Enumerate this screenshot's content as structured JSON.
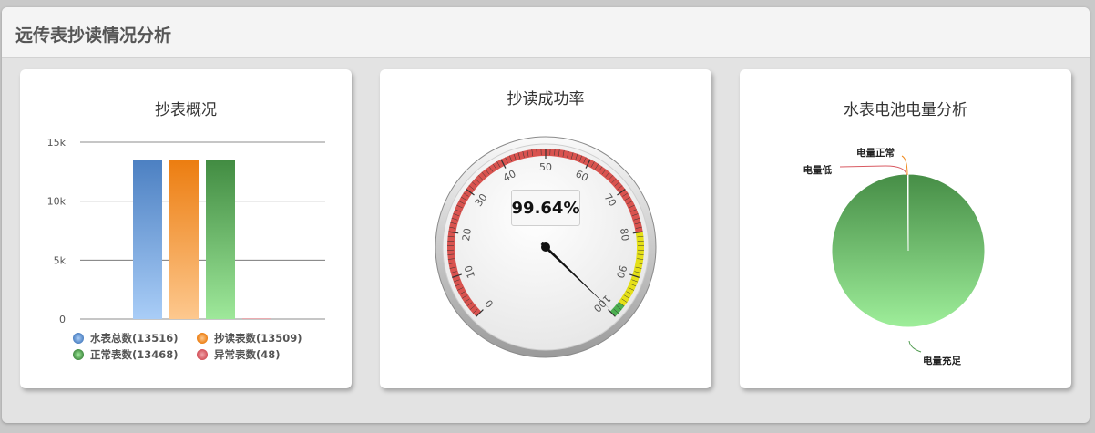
{
  "page": {
    "title": "远传表抄读情况分析"
  },
  "cards": {
    "overview": {
      "title": "抄表概况",
      "chart_data": {
        "type": "bar",
        "categories": [
          "水表总数",
          "抄读表数",
          "正常表数",
          "异常表数"
        ],
        "values": [
          13516,
          13509,
          13468,
          48
        ],
        "yticks": [
          "0",
          "5k",
          "10k",
          "15k"
        ],
        "ylim": [
          0,
          15000
        ],
        "legend": [
          "水表总数(13516)",
          "抄读表数(13509)",
          "正常表数(13468)",
          "异常表数(48)"
        ],
        "colors": [
          "#5b8fcf",
          "#f08a1e",
          "#4f9a4f",
          "#d95b63"
        ]
      }
    },
    "success": {
      "title": "抄读成功率",
      "value_text": "99.64%",
      "chart_data": {
        "type": "gauge",
        "value": 99.64,
        "min": 0,
        "max": 100,
        "tick_labels": [
          "0",
          "10",
          "20",
          "30",
          "40",
          "50",
          "60",
          "70",
          "80",
          "90",
          "100"
        ],
        "bands": [
          {
            "from": 0,
            "to": 80,
            "color": "#d9534f"
          },
          {
            "from": 80,
            "to": 97,
            "color": "#e5e017"
          },
          {
            "from": 97,
            "to": 100,
            "color": "#4caf50"
          }
        ]
      }
    },
    "battery": {
      "title": "水表电池电量分析",
      "chart_data": {
        "type": "pie",
        "categories": [
          "电量充足",
          "电量正常",
          "电量低"
        ],
        "values": [
          99.9,
          0.05,
          0.05
        ],
        "colors": [
          "#4e9a4e",
          "#f08a1e",
          "#d95b63"
        ]
      }
    }
  }
}
